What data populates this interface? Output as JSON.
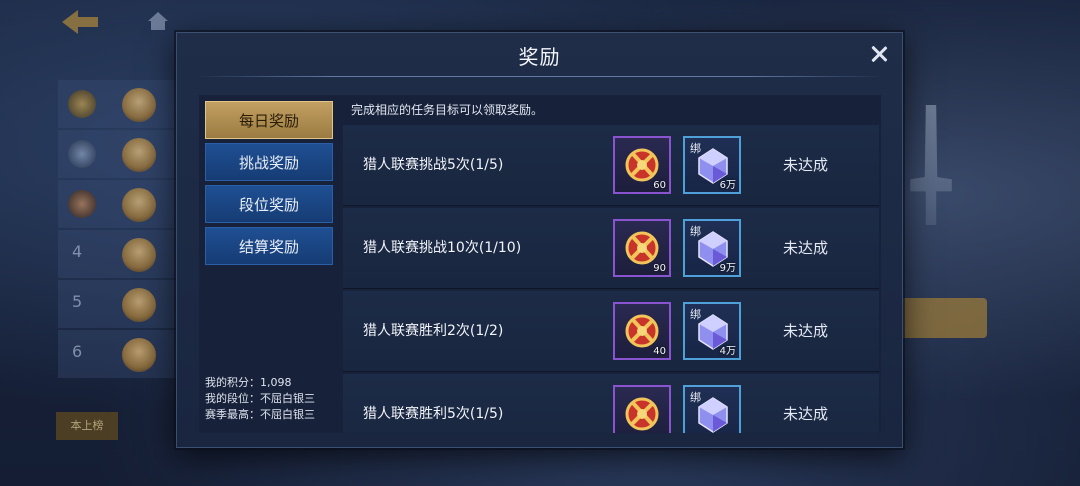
{
  "background": {
    "ranks": [
      "4",
      "5",
      "6"
    ],
    "rank_button": "本上榜"
  },
  "dialog": {
    "title": "奖励",
    "hint": "完成相应的任务目标可以领取奖励。"
  },
  "tabs": [
    {
      "label": "每日奖励",
      "active": true
    },
    {
      "label": "挑战奖励",
      "active": false
    },
    {
      "label": "段位奖励",
      "active": false
    },
    {
      "label": "结算奖励",
      "active": false
    }
  ],
  "stats": {
    "score": "我的积分：1,098",
    "rank": "我的段位：不屈白银三",
    "season_best": "赛季最高：不屈白银三"
  },
  "tasks": [
    {
      "name": "猎人联赛挑战5次(1/5)",
      "medal_count": "60",
      "gem_count": "6万",
      "bind_label": "绑",
      "status": "未达成"
    },
    {
      "name": "猎人联赛挑战10次(1/10)",
      "medal_count": "90",
      "gem_count": "9万",
      "bind_label": "绑",
      "status": "未达成"
    },
    {
      "name": "猎人联赛胜利2次(1/2)",
      "medal_count": "40",
      "gem_count": "4万",
      "bind_label": "绑",
      "status": "未达成"
    },
    {
      "name": "猎人联赛胜利5次(1/5)",
      "medal_count": "",
      "gem_count": "",
      "bind_label": "绑",
      "status": "未达成"
    }
  ],
  "icons": {
    "medal": "medal-icon",
    "gem": "gem-icon",
    "close": "close-icon"
  },
  "colors": {
    "active_tab": "#c2a062",
    "tab": "#1f4f93",
    "purple_frame": "#8a54d0",
    "cyan_frame": "#4fa0d8"
  }
}
